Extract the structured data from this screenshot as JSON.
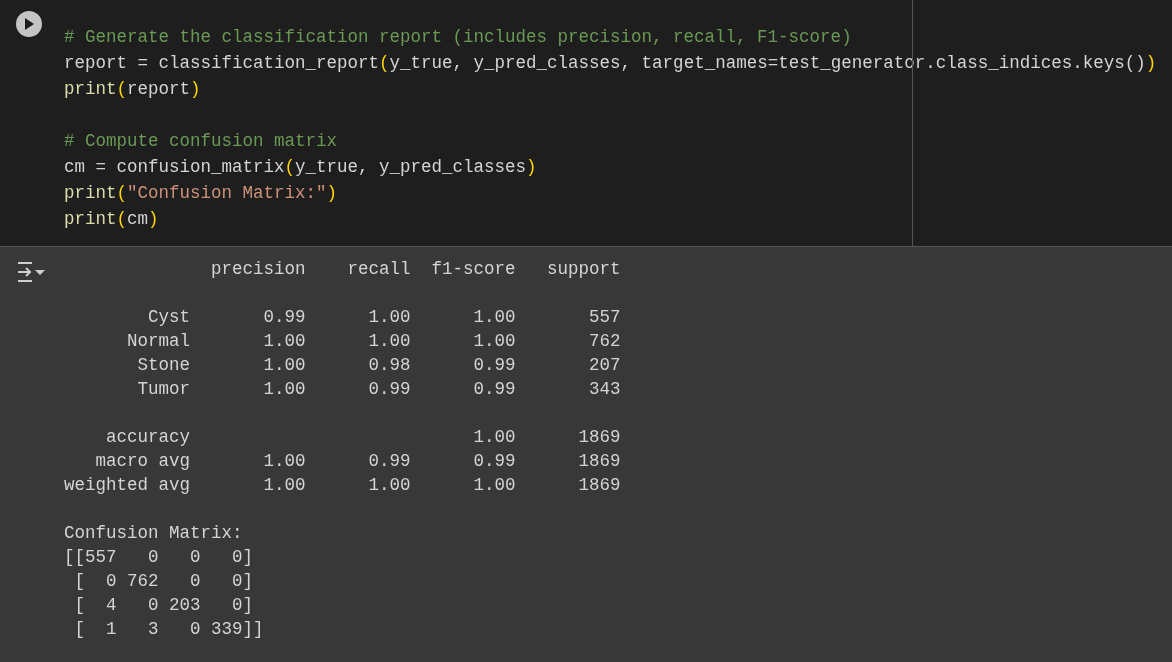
{
  "code_cell": {
    "blocks": [
      [
        [
          {
            "kind": "comment",
            "text": "# Generate the classification report (includes precision, recall, F1-score)"
          }
        ],
        [
          {
            "kind": "text",
            "text": "report = classification_report"
          },
          {
            "kind": "paren",
            "text": "("
          },
          {
            "kind": "text",
            "text": "y_true, y_pred_classes, target_names=test_generator.class_indices.keys()"
          },
          {
            "kind": "paren",
            "text": ")"
          }
        ],
        [
          {
            "kind": "func",
            "text": "print"
          },
          {
            "kind": "paren",
            "text": "("
          },
          {
            "kind": "text",
            "text": "report"
          },
          {
            "kind": "paren",
            "text": ")"
          }
        ]
      ],
      [
        [
          {
            "kind": "comment",
            "text": "# Compute confusion matrix"
          }
        ],
        [
          {
            "kind": "text",
            "text": "cm = confusion_matrix"
          },
          {
            "kind": "paren",
            "text": "("
          },
          {
            "kind": "text",
            "text": "y_true, y_pred_classes"
          },
          {
            "kind": "paren",
            "text": ")"
          }
        ],
        [
          {
            "kind": "func",
            "text": "print"
          },
          {
            "kind": "paren",
            "text": "("
          },
          {
            "kind": "string",
            "text": "\"Confusion Matrix:\""
          },
          {
            "kind": "paren",
            "text": ")"
          }
        ],
        [
          {
            "kind": "func",
            "text": "print"
          },
          {
            "kind": "paren",
            "text": "("
          },
          {
            "kind": "text",
            "text": "cm"
          },
          {
            "kind": "paren",
            "text": ")"
          }
        ]
      ]
    ]
  },
  "output": {
    "blocks": [
      [
        "              precision    recall  f1-score   support"
      ],
      [
        "        Cyst       0.99      1.00      1.00       557",
        "      Normal       1.00      1.00      1.00       762",
        "       Stone       1.00      0.98      0.99       207",
        "       Tumor       1.00      0.99      0.99       343"
      ],
      [
        "    accuracy                           1.00      1869",
        "   macro avg       1.00      0.99      0.99      1869",
        "weighted avg       1.00      1.00      1.00      1869"
      ],
      [
        "Confusion Matrix:",
        "[[557   0   0   0]",
        " [  0 762   0   0]",
        " [  4   0 203   0]",
        " [  1   3   0 339]]"
      ]
    ]
  }
}
